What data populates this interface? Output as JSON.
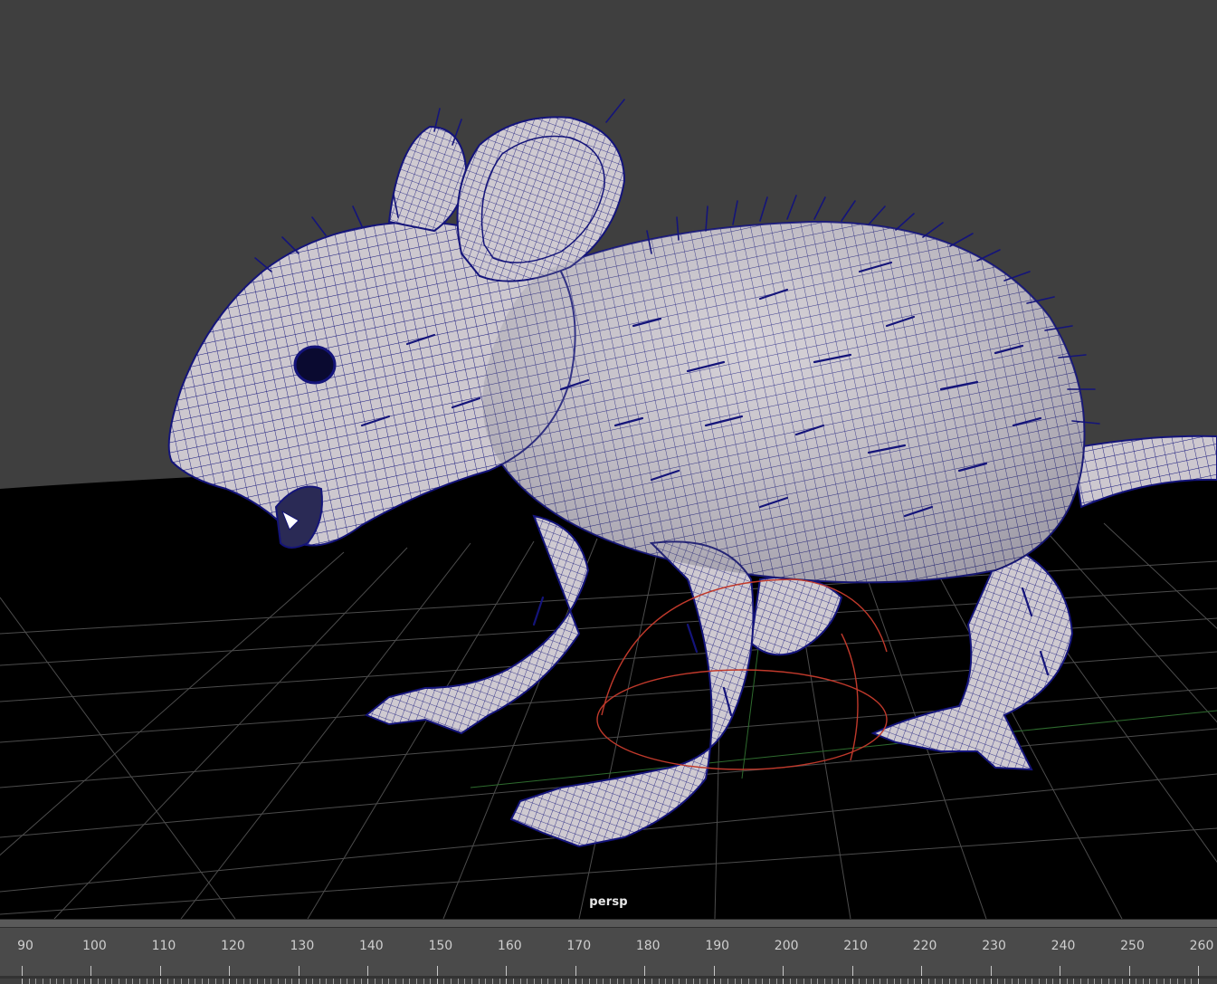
{
  "viewport": {
    "camera": "persp",
    "background_color": "#3f3f3f",
    "ground_color": "#000000",
    "grid_color": "#5a5a5a",
    "wireframe_color": "#14147a",
    "mesh_color": "#cdc8cf",
    "manipulator_color": "#c0392b"
  },
  "timeline": {
    "ticks": [
      90,
      100,
      110,
      120,
      130,
      140,
      150,
      160,
      170,
      180,
      190,
      200,
      210,
      220,
      230,
      240,
      250,
      260
    ],
    "labels": [
      "90",
      "100",
      "110",
      "120",
      "130",
      "140",
      "150",
      "160",
      "170",
      "180",
      "190",
      "200",
      "210",
      "220",
      "230",
      "240",
      "250",
      "260"
    ]
  }
}
